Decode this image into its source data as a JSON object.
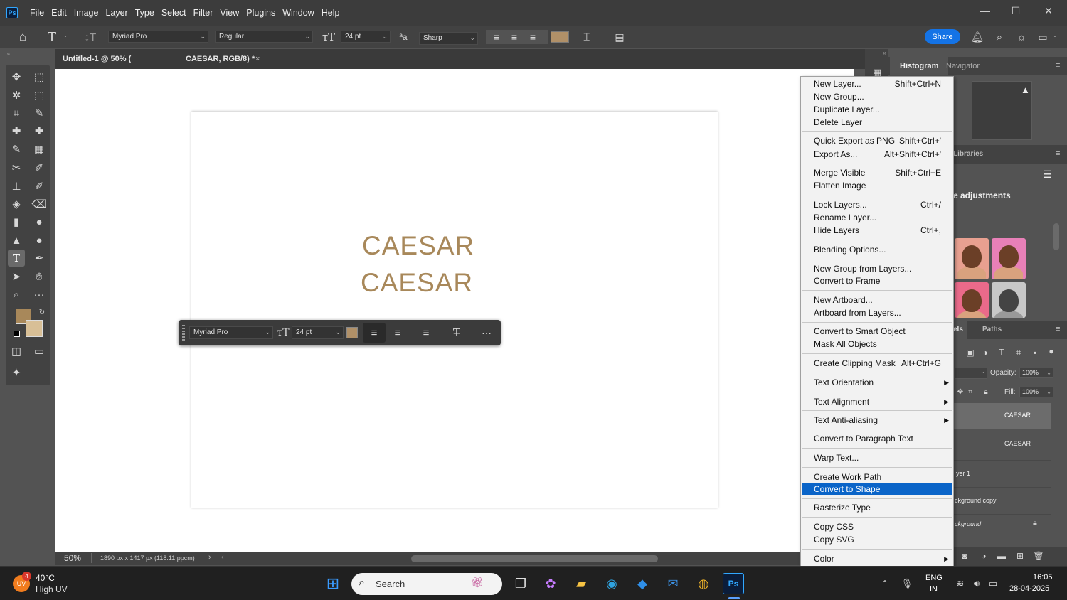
{
  "app": {
    "logo": "Ps"
  },
  "menubar": [
    "File",
    "Edit",
    "Image",
    "Layer",
    "Type",
    "Select",
    "Filter",
    "View",
    "Plugins",
    "Window",
    "Help"
  ],
  "window_controls": {
    "minimize": "—",
    "maximize": "☐",
    "close": "✕"
  },
  "options": {
    "font_family": "Myriad Pro",
    "font_style": "Regular",
    "font_size": "24 pt",
    "aa_label": "ªa",
    "anti_alias": "Sharp",
    "text_color": "#b09068",
    "share": "Share"
  },
  "tabs": [
    {
      "label": "Untitled-1 @ 50% ("
    },
    {
      "label": "CAESAR, RGB/8) *",
      "close": "×"
    }
  ],
  "canvas": {
    "text_lines": [
      "CAESAR",
      "CAESAR"
    ],
    "text_color": "#a8885a"
  },
  "context_toolbar": {
    "font_family": "Myriad Pro",
    "font_size": "24 pt",
    "color": "#b09068",
    "more": "···"
  },
  "status": {
    "zoom": "50%",
    "doc_info": "1890 px x 1417 px (118.11 ppcm)",
    "arrow": "›",
    "back": "‹"
  },
  "panels": {
    "histogram_tab": "Histogram",
    "navigator_tab": "Navigator",
    "libraries_tab": "Libraries",
    "adjustments_title": "e adjustments",
    "layers_tab_partial": "els",
    "paths_tab": "Paths",
    "opacity_label": "Opacity:",
    "opacity_value": "100%",
    "fill_label": "Fill:",
    "fill_value": "100%",
    "layers": [
      "CAESAR",
      "CAESAR",
      "yer 1",
      "ckground copy",
      "ckground"
    ]
  },
  "context_menu": {
    "groups": [
      [
        {
          "label": "New Layer...",
          "shortcut": "Shift+Ctrl+N"
        },
        {
          "label": "New Group...",
          "shortcut": ""
        },
        {
          "label": "Duplicate Layer...",
          "shortcut": ""
        },
        {
          "label": "Delete Layer",
          "shortcut": ""
        }
      ],
      [
        {
          "label": "Quick Export as PNG",
          "shortcut": "Shift+Ctrl+'"
        },
        {
          "label": "Export As...",
          "shortcut": "Alt+Shift+Ctrl+'"
        }
      ],
      [
        {
          "label": "Merge Visible",
          "shortcut": "Shift+Ctrl+E"
        },
        {
          "label": "Flatten Image",
          "shortcut": ""
        }
      ],
      [
        {
          "label": "Lock Layers...",
          "shortcut": "Ctrl+/"
        },
        {
          "label": "Rename Layer...",
          "shortcut": ""
        },
        {
          "label": "Hide Layers",
          "shortcut": "Ctrl+,"
        }
      ],
      [
        {
          "label": "Blending Options...",
          "shortcut": ""
        }
      ],
      [
        {
          "label": "New Group from Layers...",
          "shortcut": ""
        },
        {
          "label": "Convert to Frame",
          "shortcut": ""
        }
      ],
      [
        {
          "label": "New Artboard...",
          "shortcut": ""
        },
        {
          "label": "Artboard from Layers...",
          "shortcut": ""
        }
      ],
      [
        {
          "label": "Convert to Smart Object",
          "shortcut": ""
        },
        {
          "label": "Mask All Objects",
          "shortcut": ""
        }
      ],
      [
        {
          "label": "Create Clipping Mask",
          "shortcut": "Alt+Ctrl+G"
        }
      ],
      [
        {
          "label": "Text Orientation",
          "shortcut": "",
          "submenu": true
        }
      ],
      [
        {
          "label": "Text Alignment",
          "shortcut": "",
          "submenu": true
        }
      ],
      [
        {
          "label": "Text Anti-aliasing",
          "shortcut": "",
          "submenu": true
        }
      ],
      [
        {
          "label": "Convert to Paragraph Text",
          "shortcut": ""
        }
      ],
      [
        {
          "label": "Warp Text...",
          "shortcut": ""
        }
      ],
      [
        {
          "label": "Create Work Path",
          "shortcut": ""
        },
        {
          "label": "Convert to Shape",
          "shortcut": "",
          "highlighted": true
        }
      ],
      [
        {
          "label": "Rasterize Type",
          "shortcut": ""
        }
      ],
      [
        {
          "label": "Copy CSS",
          "shortcut": ""
        },
        {
          "label": "Copy SVG",
          "shortcut": ""
        }
      ],
      [
        {
          "label": "Color",
          "shortcut": "",
          "submenu": true
        }
      ]
    ]
  },
  "taskbar": {
    "weather_temp": "40°C",
    "weather_desc": "High UV",
    "weather_badge": "4",
    "search": "Search",
    "lang1": "ENG",
    "lang2": "IN",
    "time": "16:05",
    "date": "28-04-2025"
  }
}
